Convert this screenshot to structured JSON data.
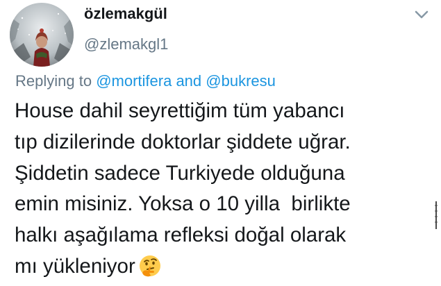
{
  "tweet": {
    "display_name": "özlemakgül",
    "handle": "@zlemakgl1",
    "avatar_icon": "profile-photo-woman-in-snow",
    "menu_icon": "chevron-down-icon",
    "reply_context": {
      "prefix": "Replying to ",
      "mention_1": "@mortifera",
      "joiner": " and ",
      "mention_2": "@bukresu"
    },
    "text_lines": [
      "House dahil seyrettiğim tüm yabancı",
      "tıp dizilerinde doktorlar şiddete uğrar.",
      "Şiddetin sadece Turkiyede olduğuna",
      "emin misiniz. Yoksa o 10 yilla  birlikte",
      "halkı aşağılama refleksi doğal olarak",
      "mı yükleniyor"
    ],
    "trailing_emoji": "thinking-face-emoji"
  },
  "colors": {
    "text": "#14171a",
    "secondary": "#657786",
    "link": "#1b95e0"
  }
}
